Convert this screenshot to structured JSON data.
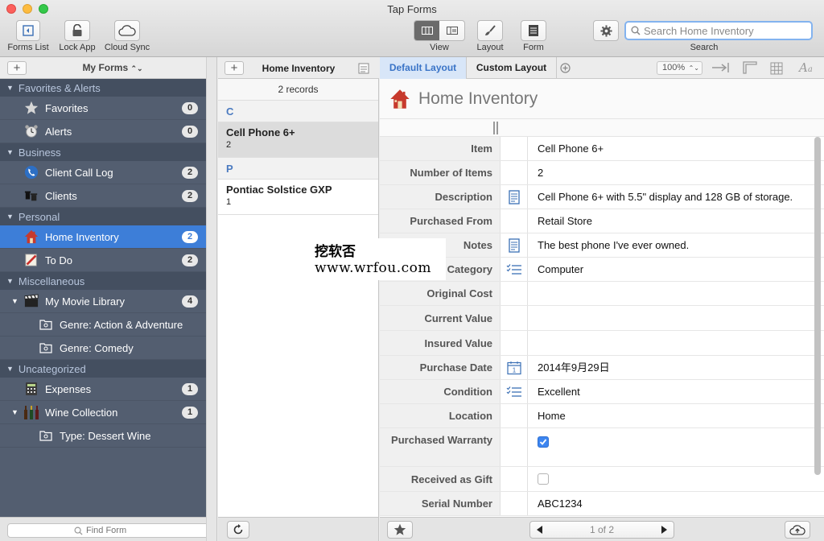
{
  "window": {
    "title": "Tap Forms"
  },
  "toolbar": {
    "forms_list": "Forms List",
    "lock_app": "Lock App",
    "cloud_sync": "Cloud Sync",
    "view": "View",
    "layout": "Layout",
    "form": "Form",
    "search_label": "Search",
    "search_placeholder": "Search Home Inventory"
  },
  "sidebar": {
    "header": "My Forms",
    "groups": [
      {
        "title": "Favorites & Alerts",
        "items": [
          {
            "label": "Favorites",
            "count": "0",
            "icon": "star-icon"
          },
          {
            "label": "Alerts",
            "count": "0",
            "icon": "alarm-clock-icon"
          }
        ]
      },
      {
        "title": "Business",
        "items": [
          {
            "label": "Client Call Log",
            "count": "2",
            "icon": "phone-icon"
          },
          {
            "label": "Clients",
            "count": "2",
            "icon": "clients-icon"
          }
        ]
      },
      {
        "title": "Personal",
        "items": [
          {
            "label": "Home Inventory",
            "count": "2",
            "icon": "house-icon",
            "selected": true
          },
          {
            "label": "To Do",
            "count": "2",
            "icon": "todo-icon"
          }
        ]
      },
      {
        "title": "Miscellaneous",
        "items": [
          {
            "label": "My Movie Library",
            "count": "4",
            "icon": "clapperboard-icon"
          },
          {
            "label": "Genre: Action & Adventure",
            "icon": "saved-search-icon"
          },
          {
            "label": "Genre: Comedy",
            "icon": "saved-search-icon"
          }
        ]
      },
      {
        "title": "Uncategorized",
        "items": [
          {
            "label": "Expenses",
            "count": "1",
            "icon": "calculator-icon"
          },
          {
            "label": "Wine Collection",
            "count": "1",
            "icon": "wine-bottles-icon"
          },
          {
            "label": "Type: Dessert Wine",
            "icon": "saved-search-icon"
          }
        ]
      }
    ],
    "find_placeholder": "Find Form"
  },
  "list": {
    "header": "Home Inventory",
    "record_count": "2 records",
    "sections": [
      {
        "letter": "C",
        "records": [
          {
            "title": "Cell Phone 6+",
            "sub": "2",
            "selected": true
          }
        ]
      },
      {
        "letter": "P",
        "records": [
          {
            "title": "Pontiac Solstice GXP",
            "sub": "1"
          }
        ]
      }
    ]
  },
  "detail": {
    "tabs": [
      "Default Layout",
      "Custom Layout"
    ],
    "zoom": "100%",
    "form_title": "Home Inventory",
    "fields": [
      {
        "label": "Item",
        "value": "Cell Phone 6+"
      },
      {
        "label": "Number of Items",
        "value": "2"
      },
      {
        "label": "Description",
        "value": "Cell Phone 6+ with 5.5\" display and 128 GB of storage.",
        "icon": "note-icon"
      },
      {
        "label": "Purchased From",
        "value": "Retail Store"
      },
      {
        "label": "Notes",
        "value": "The best phone I've ever owned.",
        "icon": "note-icon"
      },
      {
        "label": "Category",
        "value": "Computer",
        "icon": "pick-list-icon"
      },
      {
        "label": "Original Cost",
        "value": ""
      },
      {
        "label": "Current Value",
        "value": ""
      },
      {
        "label": "Insured Value",
        "value": ""
      },
      {
        "label": "Purchase Date",
        "value": "2014年9月29日",
        "icon": "calendar-icon"
      },
      {
        "label": "Condition",
        "value": "Excellent",
        "icon": "pick-list-icon"
      },
      {
        "label": "Location",
        "value": "Home"
      },
      {
        "label": "Purchased Warranty",
        "checkbox": true,
        "checked": true
      },
      {
        "label": "Received as Gift",
        "checkbox": true,
        "checked": false
      },
      {
        "label": "Serial Number",
        "value": "ABC1234"
      }
    ],
    "pager": "1 of 2"
  },
  "watermark": {
    "line1": "挖软否",
    "line2": "www.wrfou.com"
  }
}
